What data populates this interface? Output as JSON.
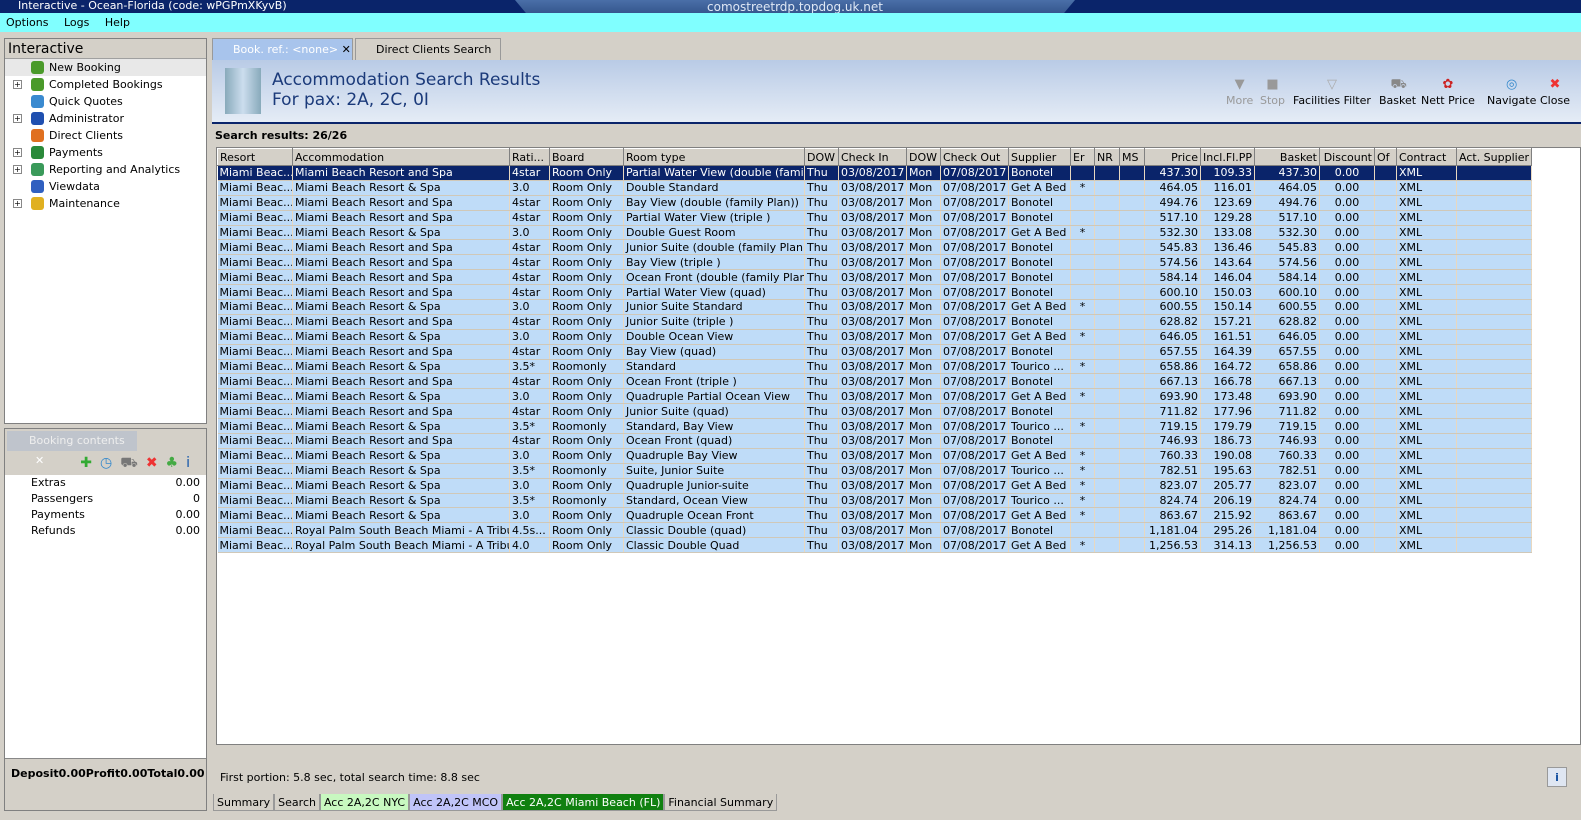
{
  "window": {
    "title": "Interactive - Ocean-Florida (code: wPGPmXKyvB)",
    "rdp_host": "comostreetrdp.topdog.uk.net"
  },
  "menu": [
    "Options",
    "Logs",
    "Help"
  ],
  "left_panel": {
    "title": "Interactive",
    "items": [
      {
        "label": "New Booking",
        "expandable": false,
        "color": "#4a9a2a"
      },
      {
        "label": "Completed Bookings",
        "expandable": true,
        "color": "#4a9a2a"
      },
      {
        "label": "Quick Quotes",
        "expandable": false,
        "color": "#3a8ad0"
      },
      {
        "label": "Administrator",
        "expandable": true,
        "color": "#2050b0"
      },
      {
        "label": "Direct Clients",
        "expandable": false,
        "color": "#e07020"
      },
      {
        "label": "Payments",
        "expandable": true,
        "color": "#2a8a3a"
      },
      {
        "label": "Reporting and Analytics",
        "expandable": true,
        "color": "#3a9a5a"
      },
      {
        "label": "Viewdata",
        "expandable": false,
        "color": "#3060c0"
      },
      {
        "label": "Maintenance",
        "expandable": true,
        "color": "#e0b020"
      }
    ]
  },
  "booking_contents": {
    "title": "Booking contents",
    "rows": [
      {
        "label": "Extras",
        "value": "0.00"
      },
      {
        "label": "Passengers",
        "value": "0"
      },
      {
        "label": "Payments",
        "value": "0.00"
      },
      {
        "label": "Refunds",
        "value": "0.00"
      }
    ],
    "totals": [
      {
        "label": "Deposit",
        "value": "0.00"
      },
      {
        "label": "Profit",
        "value": "0.00"
      },
      {
        "label": "Total",
        "value": "0.00"
      }
    ]
  },
  "tabs": [
    {
      "label": "Book. ref.: <none>",
      "active": true
    },
    {
      "label": "Direct Clients Search",
      "active": false
    }
  ],
  "header": {
    "title": "Accommodation Search Results",
    "subtitle": "For pax: 2A, 2C, 0I"
  },
  "toolbar": {
    "more": "More",
    "stop": "Stop",
    "facilities": "Facilities Filter",
    "basket": "Basket",
    "nett": "Nett Price",
    "navigate": "Navigate",
    "close": "Close"
  },
  "results_count": "Search results: 26/26",
  "columns": [
    "Resort",
    "Accommodation",
    "Rati...",
    "Board",
    "Room type",
    "DOW",
    "Check In",
    "DOW",
    "Check Out",
    "Supplier",
    "Er",
    "NR",
    "MS",
    "Price",
    "Incl.Fl.PP",
    "Basket",
    "Discount",
    "Of",
    "Contract",
    "Act. Supplier"
  ],
  "rows": [
    [
      "Miami Beac...",
      "Miami Beach Resort and Spa",
      "4star",
      "Room Only",
      "Partial Water View (double (family...",
      "Thu",
      "03/08/2017",
      "Mon",
      "07/08/2017",
      "Bonotel",
      "",
      "",
      "",
      "437.30",
      "109.33",
      "437.30",
      "0.00",
      "",
      "XML",
      ""
    ],
    [
      "Miami Beac...",
      "Miami Beach Resort & Spa",
      "3.0",
      "Room Only",
      "Double Standard",
      "Thu",
      "03/08/2017",
      "Mon",
      "07/08/2017",
      "Get A Bed",
      "*",
      "",
      "",
      "464.05",
      "116.01",
      "464.05",
      "0.00",
      "",
      "XML",
      ""
    ],
    [
      "Miami Beac...",
      "Miami Beach Resort and Spa",
      "4star",
      "Room Only",
      "Bay View (double (family Plan))",
      "Thu",
      "03/08/2017",
      "Mon",
      "07/08/2017",
      "Bonotel",
      "",
      "",
      "",
      "494.76",
      "123.69",
      "494.76",
      "0.00",
      "",
      "XML",
      ""
    ],
    [
      "Miami Beac...",
      "Miami Beach Resort and Spa",
      "4star",
      "Room Only",
      "Partial Water View (triple )",
      "Thu",
      "03/08/2017",
      "Mon",
      "07/08/2017",
      "Bonotel",
      "",
      "",
      "",
      "517.10",
      "129.28",
      "517.10",
      "0.00",
      "",
      "XML",
      ""
    ],
    [
      "Miami Beac...",
      "Miami Beach Resort & Spa",
      "3.0",
      "Room Only",
      "Double Guest Room",
      "Thu",
      "03/08/2017",
      "Mon",
      "07/08/2017",
      "Get A Bed",
      "*",
      "",
      "",
      "532.30",
      "133.08",
      "532.30",
      "0.00",
      "",
      "XML",
      ""
    ],
    [
      "Miami Beac...",
      "Miami Beach Resort and Spa",
      "4star",
      "Room Only",
      "Junior Suite (double (family Plan))",
      "Thu",
      "03/08/2017",
      "Mon",
      "07/08/2017",
      "Bonotel",
      "",
      "",
      "",
      "545.83",
      "136.46",
      "545.83",
      "0.00",
      "",
      "XML",
      ""
    ],
    [
      "Miami Beac...",
      "Miami Beach Resort and Spa",
      "4star",
      "Room Only",
      "Bay View (triple )",
      "Thu",
      "03/08/2017",
      "Mon",
      "07/08/2017",
      "Bonotel",
      "",
      "",
      "",
      "574.56",
      "143.64",
      "574.56",
      "0.00",
      "",
      "XML",
      ""
    ],
    [
      "Miami Beac...",
      "Miami Beach Resort and Spa",
      "4star",
      "Room Only",
      "Ocean Front (double (family Plan))",
      "Thu",
      "03/08/2017",
      "Mon",
      "07/08/2017",
      "Bonotel",
      "",
      "",
      "",
      "584.14",
      "146.04",
      "584.14",
      "0.00",
      "",
      "XML",
      ""
    ],
    [
      "Miami Beac...",
      "Miami Beach Resort and Spa",
      "4star",
      "Room Only",
      "Partial Water View (quad)",
      "Thu",
      "03/08/2017",
      "Mon",
      "07/08/2017",
      "Bonotel",
      "",
      "",
      "",
      "600.10",
      "150.03",
      "600.10",
      "0.00",
      "",
      "XML",
      ""
    ],
    [
      "Miami Beac...",
      "Miami Beach Resort & Spa",
      "3.0",
      "Room Only",
      "Junior Suite Standard",
      "Thu",
      "03/08/2017",
      "Mon",
      "07/08/2017",
      "Get A Bed",
      "*",
      "",
      "",
      "600.55",
      "150.14",
      "600.55",
      "0.00",
      "",
      "XML",
      ""
    ],
    [
      "Miami Beac...",
      "Miami Beach Resort and Spa",
      "4star",
      "Room Only",
      "Junior Suite (triple )",
      "Thu",
      "03/08/2017",
      "Mon",
      "07/08/2017",
      "Bonotel",
      "",
      "",
      "",
      "628.82",
      "157.21",
      "628.82",
      "0.00",
      "",
      "XML",
      ""
    ],
    [
      "Miami Beac...",
      "Miami Beach Resort & Spa",
      "3.0",
      "Room Only",
      "Double Ocean View",
      "Thu",
      "03/08/2017",
      "Mon",
      "07/08/2017",
      "Get A Bed",
      "*",
      "",
      "",
      "646.05",
      "161.51",
      "646.05",
      "0.00",
      "",
      "XML",
      ""
    ],
    [
      "Miami Beac...",
      "Miami Beach Resort and Spa",
      "4star",
      "Room Only",
      "Bay View (quad)",
      "Thu",
      "03/08/2017",
      "Mon",
      "07/08/2017",
      "Bonotel",
      "",
      "",
      "",
      "657.55",
      "164.39",
      "657.55",
      "0.00",
      "",
      "XML",
      ""
    ],
    [
      "Miami Beac...",
      "Miami Beach Resort & Spa",
      "3.5*",
      "Roomonly",
      "Standard",
      "Thu",
      "03/08/2017",
      "Mon",
      "07/08/2017",
      "Tourico ...",
      "*",
      "",
      "",
      "658.86",
      "164.72",
      "658.86",
      "0.00",
      "",
      "XML",
      ""
    ],
    [
      "Miami Beac...",
      "Miami Beach Resort and Spa",
      "4star",
      "Room Only",
      "Ocean Front (triple )",
      "Thu",
      "03/08/2017",
      "Mon",
      "07/08/2017",
      "Bonotel",
      "",
      "",
      "",
      "667.13",
      "166.78",
      "667.13",
      "0.00",
      "",
      "XML",
      ""
    ],
    [
      "Miami Beac...",
      "Miami Beach Resort & Spa",
      "3.0",
      "Room Only",
      "Quadruple Partial Ocean View",
      "Thu",
      "03/08/2017",
      "Mon",
      "07/08/2017",
      "Get A Bed",
      "*",
      "",
      "",
      "693.90",
      "173.48",
      "693.90",
      "0.00",
      "",
      "XML",
      ""
    ],
    [
      "Miami Beac...",
      "Miami Beach Resort and Spa",
      "4star",
      "Room Only",
      "Junior Suite (quad)",
      "Thu",
      "03/08/2017",
      "Mon",
      "07/08/2017",
      "Bonotel",
      "",
      "",
      "",
      "711.82",
      "177.96",
      "711.82",
      "0.00",
      "",
      "XML",
      ""
    ],
    [
      "Miami Beac...",
      "Miami Beach Resort & Spa",
      "3.5*",
      "Roomonly",
      "Standard, Bay View",
      "Thu",
      "03/08/2017",
      "Mon",
      "07/08/2017",
      "Tourico ...",
      "*",
      "",
      "",
      "719.15",
      "179.79",
      "719.15",
      "0.00",
      "",
      "XML",
      ""
    ],
    [
      "Miami Beac...",
      "Miami Beach Resort and Spa",
      "4star",
      "Room Only",
      "Ocean Front (quad)",
      "Thu",
      "03/08/2017",
      "Mon",
      "07/08/2017",
      "Bonotel",
      "",
      "",
      "",
      "746.93",
      "186.73",
      "746.93",
      "0.00",
      "",
      "XML",
      ""
    ],
    [
      "Miami Beac...",
      "Miami Beach Resort & Spa",
      "3.0",
      "Room Only",
      "Quadruple Bay View",
      "Thu",
      "03/08/2017",
      "Mon",
      "07/08/2017",
      "Get A Bed",
      "*",
      "",
      "",
      "760.33",
      "190.08",
      "760.33",
      "0.00",
      "",
      "XML",
      ""
    ],
    [
      "Miami Beac...",
      "Miami Beach Resort & Spa",
      "3.5*",
      "Roomonly",
      "Suite, Junior Suite",
      "Thu",
      "03/08/2017",
      "Mon",
      "07/08/2017",
      "Tourico ...",
      "*",
      "",
      "",
      "782.51",
      "195.63",
      "782.51",
      "0.00",
      "",
      "XML",
      ""
    ],
    [
      "Miami Beac...",
      "Miami Beach Resort & Spa",
      "3.0",
      "Room Only",
      "Quadruple Junior-suite",
      "Thu",
      "03/08/2017",
      "Mon",
      "07/08/2017",
      "Get A Bed",
      "*",
      "",
      "",
      "823.07",
      "205.77",
      "823.07",
      "0.00",
      "",
      "XML",
      ""
    ],
    [
      "Miami Beac...",
      "Miami Beach Resort & Spa",
      "3.5*",
      "Roomonly",
      "Standard, Ocean View",
      "Thu",
      "03/08/2017",
      "Mon",
      "07/08/2017",
      "Tourico ...",
      "*",
      "",
      "",
      "824.74",
      "206.19",
      "824.74",
      "0.00",
      "",
      "XML",
      ""
    ],
    [
      "Miami Beac...",
      "Miami Beach Resort & Spa",
      "3.0",
      "Room Only",
      "Quadruple Ocean Front",
      "Thu",
      "03/08/2017",
      "Mon",
      "07/08/2017",
      "Get A Bed",
      "*",
      "",
      "",
      "863.67",
      "215.92",
      "863.67",
      "0.00",
      "",
      "XML",
      ""
    ],
    [
      "Miami Beac...",
      "Royal Palm South Beach Miami - A Tribute ...",
      "4.5s...",
      "Room Only",
      "Classic Double (quad)",
      "Thu",
      "03/08/2017",
      "Mon",
      "07/08/2017",
      "Bonotel",
      "",
      "",
      "",
      "1,181.04",
      "295.26",
      "1,181.04",
      "0.00",
      "",
      "XML",
      ""
    ],
    [
      "Miami Beac...",
      "Royal Palm South Beach Miami - A Tribute ...",
      "4.0",
      "Room Only",
      "Classic Double Quad",
      "Thu",
      "03/08/2017",
      "Mon",
      "07/08/2017",
      "Get A Bed",
      "*",
      "",
      "",
      "1,256.53",
      "314.13",
      "1,256.53",
      "0.00",
      "",
      "XML",
      ""
    ]
  ],
  "status": "First portion: 5.8 sec, total search time: 8.8 sec",
  "bottom_tabs": [
    {
      "label": "Summary",
      "bg": "#d4d0c8",
      "fg": "#000"
    },
    {
      "label": "Search",
      "bg": "#d4d0c8",
      "fg": "#000"
    },
    {
      "label": "Acc 2A,2C NYC",
      "bg": "#c8f8c0",
      "fg": "#000"
    },
    {
      "label": "Acc 2A,2C MCO",
      "bg": "#c0c4f8",
      "fg": "#000"
    },
    {
      "label": "Acc 2A,2C Miami Beach (FL)",
      "bg": "#108010",
      "fg": "#fff"
    },
    {
      "label": "Financial Summary",
      "bg": "#d4d0c8",
      "fg": "#000"
    }
  ]
}
